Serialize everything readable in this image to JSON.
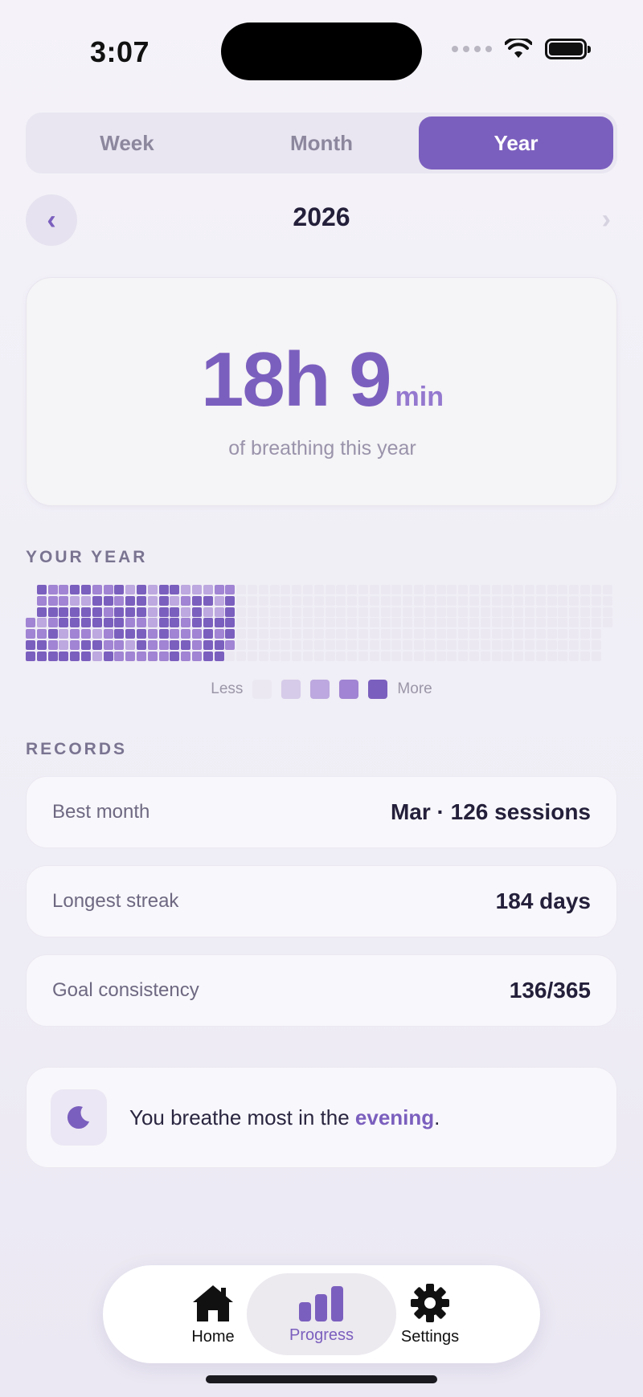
{
  "status": {
    "time": "3:07"
  },
  "segments": [
    {
      "label": "Week",
      "active": false
    },
    {
      "label": "Month",
      "active": false
    },
    {
      "label": "Year",
      "active": true
    }
  ],
  "nav": {
    "prev": "‹",
    "title": "2026",
    "next": "›"
  },
  "summary": {
    "value": "18h 9",
    "unit": "min",
    "subtitle": "of breathing this year"
  },
  "your_year": {
    "title": "YOUR YEAR",
    "legend_less": "Less",
    "legend_more": "More",
    "levels": [
      "#ebe8f2",
      "#d6cbe9",
      "#bda8df",
      "#a184d3",
      "#7b5fbe"
    ]
  },
  "records": {
    "title": "RECORDS",
    "items": [
      {
        "label": "Best month",
        "value": "Mar · 126 sessions"
      },
      {
        "label": "Longest streak",
        "value": "184 days"
      },
      {
        "label": "Goal consistency",
        "value": "136/365"
      }
    ]
  },
  "insight": {
    "prefix": "You breathe most in the ",
    "highlight": "evening",
    "suffix": "."
  },
  "tabs": [
    {
      "label": "Home",
      "icon": "house-icon",
      "active": false
    },
    {
      "label": "Progress",
      "icon": "bar-chart-icon",
      "active": true
    },
    {
      "label": "Settings",
      "icon": "gear-icon",
      "active": false
    }
  ],
  "colors": {
    "accent": "#7b5fbe"
  }
}
